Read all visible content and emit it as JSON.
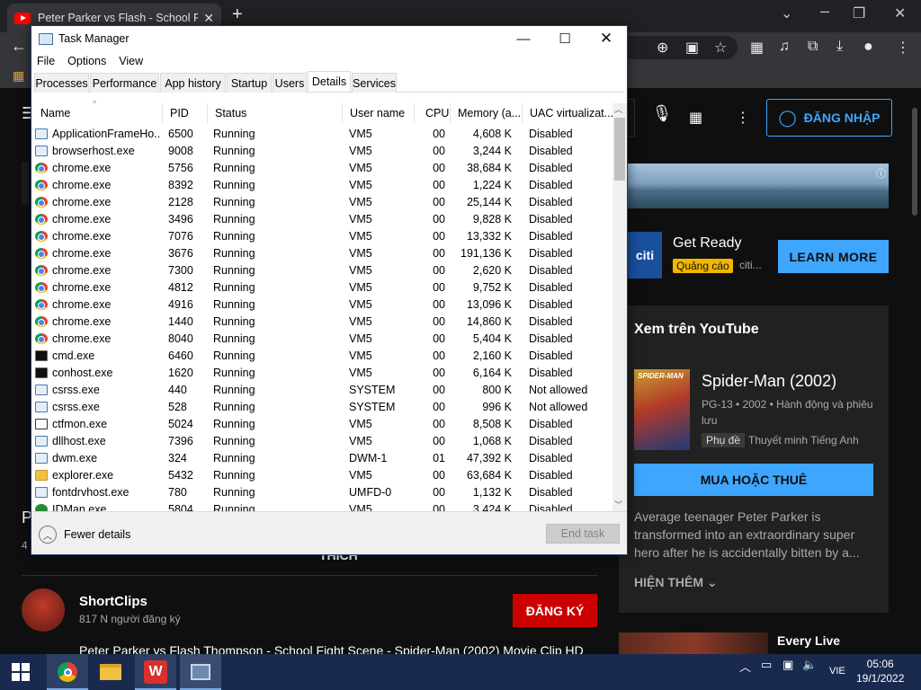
{
  "browser": {
    "tab_title": "Peter Parker vs Flash - School Fig",
    "close": "✕",
    "new_tab": "+",
    "window_controls": {
      "minimize": "⌄",
      "restore": "❐",
      "close": "✕"
    }
  },
  "youtube": {
    "signin_label": "ĐĂNG NHẬP",
    "ad_title": "Get Ready",
    "ad_badge": "Quảng cáo",
    "ad_advertiser": "citi...",
    "ad_logo": "citi",
    "ad_button": "LEARN MORE",
    "panel_heading": "Xem trên YouTube",
    "poster_text": "SPIDER-MAN",
    "movie_title": "Spider-Man (2002)",
    "movie_meta": "PG-13 • 2002 • Hành động và phiêu lưu",
    "subtitle_badge": "Phụ đề",
    "subtitle_text": "Thuyết minh Tiếng Anh",
    "buy_button": "MUA HOẶC THUÊ",
    "description": "Average teenager Peter Parker is transformed into an extraordinary super hero after he is accidentally bitten by a...",
    "show_more": "HIỆN THÊM",
    "next_title": "Every Live",
    "like_label": "THÍCH",
    "title_letter": "P",
    "views_letter": "4",
    "channel_name": "ShortClips",
    "channel_subs": "817 N người đăng ký",
    "subscribe": "ĐĂNG KÝ",
    "video_title": "Peter Parker vs Flash Thompson - School Fight Scene - Spider-Man (2002) Movie Clip HD"
  },
  "taskmanager": {
    "title": "Task Manager",
    "menu": [
      "File",
      "Options",
      "View"
    ],
    "tabs": [
      "Processes",
      "Performance",
      "App history",
      "Startup",
      "Users",
      "Details",
      "Services"
    ],
    "active_tab": "Details",
    "columns": [
      "Name",
      "PID",
      "Status",
      "User name",
      "CPU",
      "Memory (a...",
      "UAC virtualizat..."
    ],
    "rows": [
      {
        "name": "ApplicationFrameHo...",
        "pid": "6500",
        "status": "Running",
        "user": "VM5",
        "cpu": "00",
        "mem": "4,608 K",
        "uac": "Disabled",
        "icon": "app"
      },
      {
        "name": "browserhost.exe",
        "pid": "9008",
        "status": "Running",
        "user": "VM5",
        "cpu": "00",
        "mem": "3,244 K",
        "uac": "Disabled",
        "icon": "app"
      },
      {
        "name": "chrome.exe",
        "pid": "5756",
        "status": "Running",
        "user": "VM5",
        "cpu": "00",
        "mem": "38,684 K",
        "uac": "Disabled",
        "icon": "chrome"
      },
      {
        "name": "chrome.exe",
        "pid": "8392",
        "status": "Running",
        "user": "VM5",
        "cpu": "00",
        "mem": "1,224 K",
        "uac": "Disabled",
        "icon": "chrome"
      },
      {
        "name": "chrome.exe",
        "pid": "2128",
        "status": "Running",
        "user": "VM5",
        "cpu": "00",
        "mem": "25,144 K",
        "uac": "Disabled",
        "icon": "chrome"
      },
      {
        "name": "chrome.exe",
        "pid": "3496",
        "status": "Running",
        "user": "VM5",
        "cpu": "00",
        "mem": "9,828 K",
        "uac": "Disabled",
        "icon": "chrome"
      },
      {
        "name": "chrome.exe",
        "pid": "7076",
        "status": "Running",
        "user": "VM5",
        "cpu": "00",
        "mem": "13,332 K",
        "uac": "Disabled",
        "icon": "chrome"
      },
      {
        "name": "chrome.exe",
        "pid": "3676",
        "status": "Running",
        "user": "VM5",
        "cpu": "00",
        "mem": "191,136 K",
        "uac": "Disabled",
        "icon": "chrome"
      },
      {
        "name": "chrome.exe",
        "pid": "7300",
        "status": "Running",
        "user": "VM5",
        "cpu": "00",
        "mem": "2,620 K",
        "uac": "Disabled",
        "icon": "chrome"
      },
      {
        "name": "chrome.exe",
        "pid": "4812",
        "status": "Running",
        "user": "VM5",
        "cpu": "00",
        "mem": "9,752 K",
        "uac": "Disabled",
        "icon": "chrome"
      },
      {
        "name": "chrome.exe",
        "pid": "4916",
        "status": "Running",
        "user": "VM5",
        "cpu": "00",
        "mem": "13,096 K",
        "uac": "Disabled",
        "icon": "chrome"
      },
      {
        "name": "chrome.exe",
        "pid": "1440",
        "status": "Running",
        "user": "VM5",
        "cpu": "00",
        "mem": "14,860 K",
        "uac": "Disabled",
        "icon": "chrome"
      },
      {
        "name": "chrome.exe",
        "pid": "8040",
        "status": "Running",
        "user": "VM5",
        "cpu": "00",
        "mem": "5,404 K",
        "uac": "Disabled",
        "icon": "chrome"
      },
      {
        "name": "cmd.exe",
        "pid": "6460",
        "status": "Running",
        "user": "VM5",
        "cpu": "00",
        "mem": "2,160 K",
        "uac": "Disabled",
        "icon": "cmd"
      },
      {
        "name": "conhost.exe",
        "pid": "1620",
        "status": "Running",
        "user": "VM5",
        "cpu": "00",
        "mem": "6,164 K",
        "uac": "Disabled",
        "icon": "cmd"
      },
      {
        "name": "csrss.exe",
        "pid": "440",
        "status": "Running",
        "user": "SYSTEM",
        "cpu": "00",
        "mem": "800 K",
        "uac": "Not allowed",
        "icon": "app"
      },
      {
        "name": "csrss.exe",
        "pid": "528",
        "status": "Running",
        "user": "SYSTEM",
        "cpu": "00",
        "mem": "996 K",
        "uac": "Not allowed",
        "icon": "app"
      },
      {
        "name": "ctfmon.exe",
        "pid": "5024",
        "status": "Running",
        "user": "VM5",
        "cpu": "00",
        "mem": "8,508 K",
        "uac": "Disabled",
        "icon": "edit"
      },
      {
        "name": "dllhost.exe",
        "pid": "7396",
        "status": "Running",
        "user": "VM5",
        "cpu": "00",
        "mem": "1,068 K",
        "uac": "Disabled",
        "icon": "app"
      },
      {
        "name": "dwm.exe",
        "pid": "324",
        "status": "Running",
        "user": "DWM-1",
        "cpu": "01",
        "mem": "47,392 K",
        "uac": "Disabled",
        "icon": "app"
      },
      {
        "name": "explorer.exe",
        "pid": "5432",
        "status": "Running",
        "user": "VM5",
        "cpu": "00",
        "mem": "63,684 K",
        "uac": "Disabled",
        "icon": "folder"
      },
      {
        "name": "fontdrvhost.exe",
        "pid": "780",
        "status": "Running",
        "user": "UMFD-0",
        "cpu": "00",
        "mem": "1,132 K",
        "uac": "Disabled",
        "icon": "app"
      },
      {
        "name": "IDMan.exe",
        "pid": "5804",
        "status": "Running",
        "user": "VM5",
        "cpu": "00",
        "mem": "3,424 K",
        "uac": "Disabled",
        "icon": "idm"
      }
    ],
    "fewer_details": "Fewer details",
    "end_task": "End task"
  },
  "taskbar": {
    "language": "VIE",
    "time": "05:06",
    "date": "19/1/2022"
  }
}
